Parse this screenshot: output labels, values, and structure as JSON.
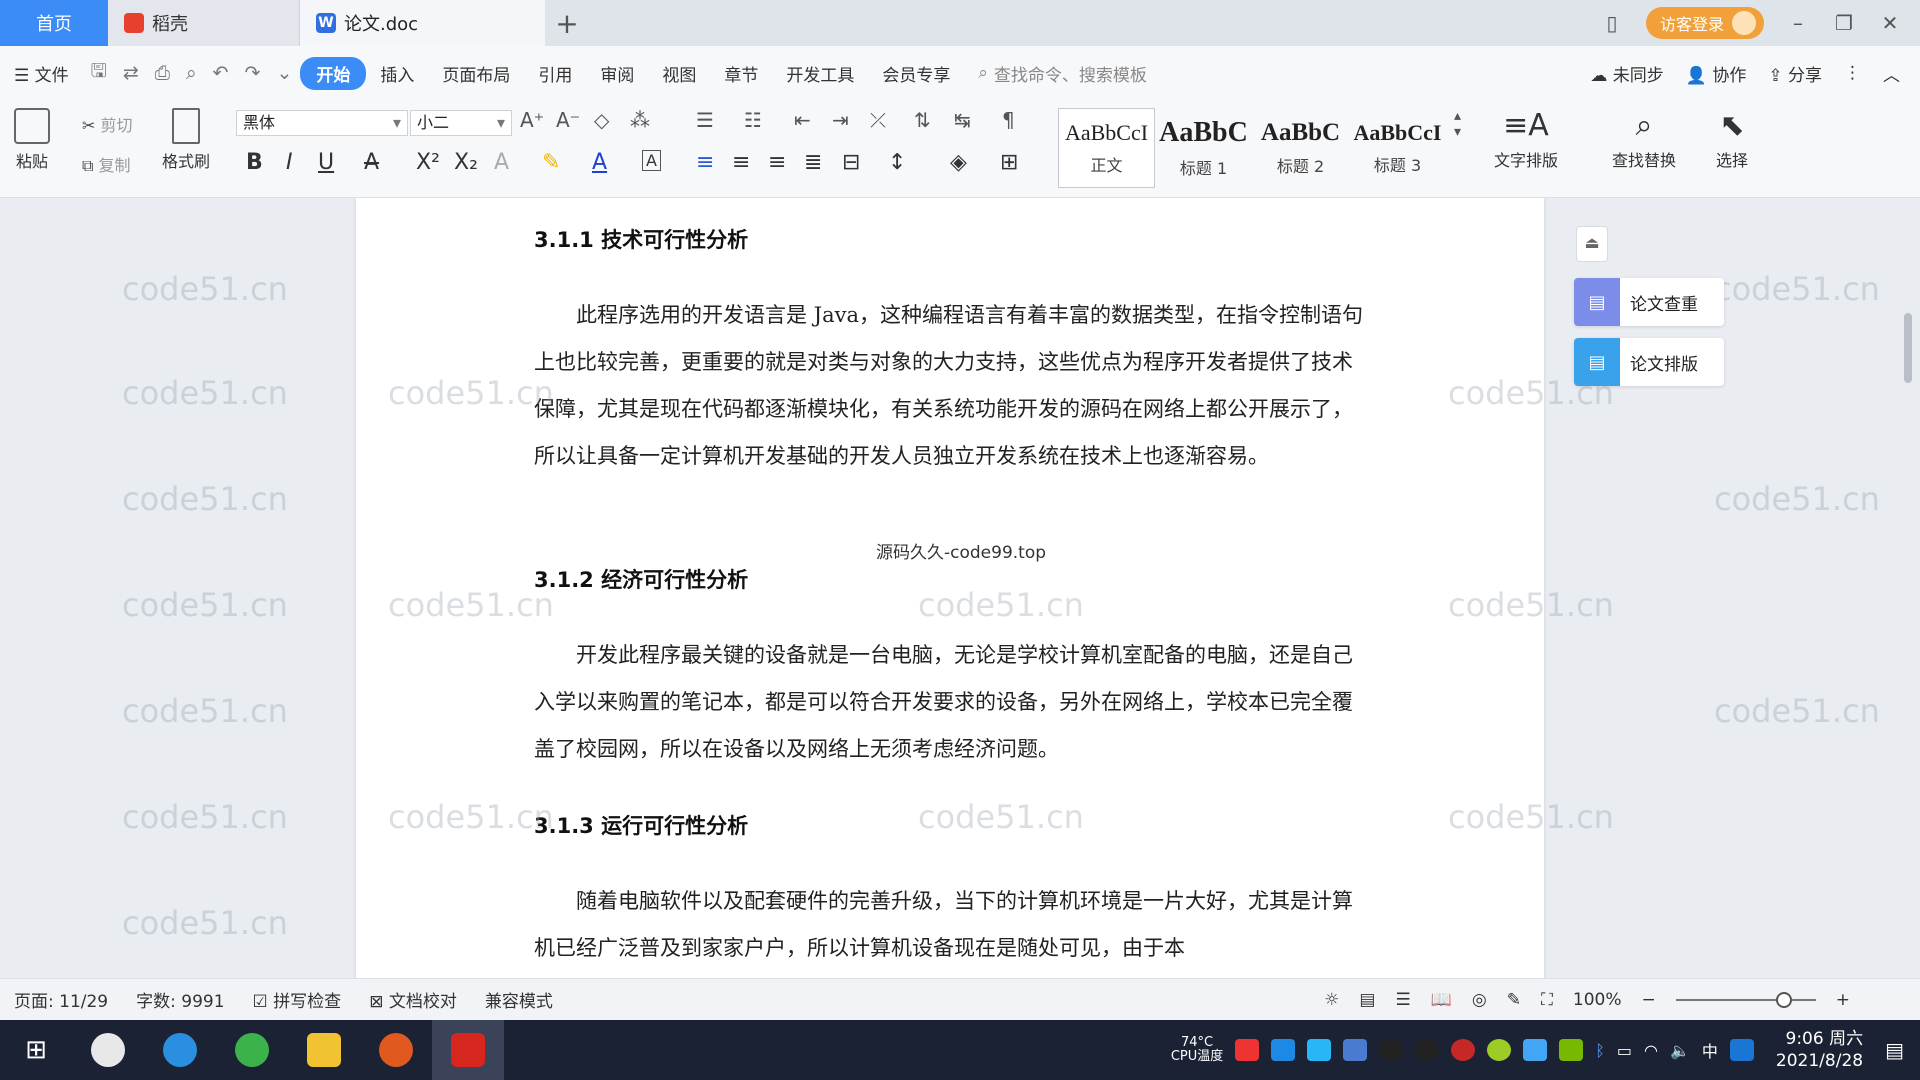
{
  "tabs": {
    "home": "首页",
    "daoke": "稻壳",
    "doc": "论文.doc",
    "new_tab": "+",
    "login": "访客登录"
  },
  "menu": {
    "file": "文件",
    "items": [
      "开始",
      "插入",
      "页面布局",
      "引用",
      "审阅",
      "视图",
      "章节",
      "开发工具",
      "会员专享"
    ],
    "search": "查找命令、搜索模板",
    "unsync": "未同步",
    "collab": "协作",
    "share": "分享"
  },
  "ribbon": {
    "paste": "粘贴",
    "cut": "剪切",
    "copy": "复制",
    "format_painter": "格式刷",
    "font_name": "黑体",
    "font_size": "小二",
    "styles": [
      {
        "preview": "AaBbCcI",
        "label": "正文"
      },
      {
        "preview": "AaBbC",
        "label": "标题 1"
      },
      {
        "preview": "AaBbC",
        "label": "标题 2"
      },
      {
        "preview": "AaBbCcI",
        "label": "标题 3"
      }
    ],
    "text_layout": "文字排版",
    "find_replace": "查找替换",
    "select": "选择"
  },
  "document": {
    "h1": "3.1.1  技术可行性分析",
    "p1": "此程序选用的开发语言是 Java，这种编程语言有着丰富的数据类型，在指令控制语句上也比较完善，更重要的就是对类与对象的大力支持，这些优点为程序开发者提供了技术保障，尤其是现在代码都逐渐模块化，有关系统功能开发的源码在网络上都公开展示了，所以让具备一定计算机开发基础的开发人员独立开发系统在技术上也逐渐容易。",
    "source_note": "源码久久-code99.top",
    "h2": "3.1.2  经济可行性分析",
    "p2": "开发此程序最关键的设备就是一台电脑，无论是学校计算机室配备的电脑，还是自己入学以来购置的笔记本，都是可以符合开发要求的设备，另外在网络上，学校本已完全覆盖了校园网，所以在设备以及网络上无须考虑经济问题。",
    "h3": "3.1.3  运行可行性分析",
    "p3": "随着电脑软件以及配套硬件的完善升级，当下的计算机环境是一片大好，尤其是计算机已经广泛普及到家家户户，所以计算机设备现在是随处可见，由于本"
  },
  "watermark": "code51.cn",
  "side": {
    "check": "论文查重",
    "layout": "论文排版"
  },
  "status": {
    "page": "页面: 11/29",
    "words": "字数: 9991",
    "spell": "拼写检查",
    "proof": "文档校对",
    "compat": "兼容模式",
    "zoom": "100%"
  },
  "taskbar": {
    "cpu_temp": "74°C",
    "cpu_label": "CPU温度",
    "ime": "中",
    "time": "9:06 周六",
    "date": "2021/8/28"
  },
  "colors": {
    "accent": "#3c8cf7",
    "login": "#f2a13a",
    "taskbar": "#1b2234"
  }
}
